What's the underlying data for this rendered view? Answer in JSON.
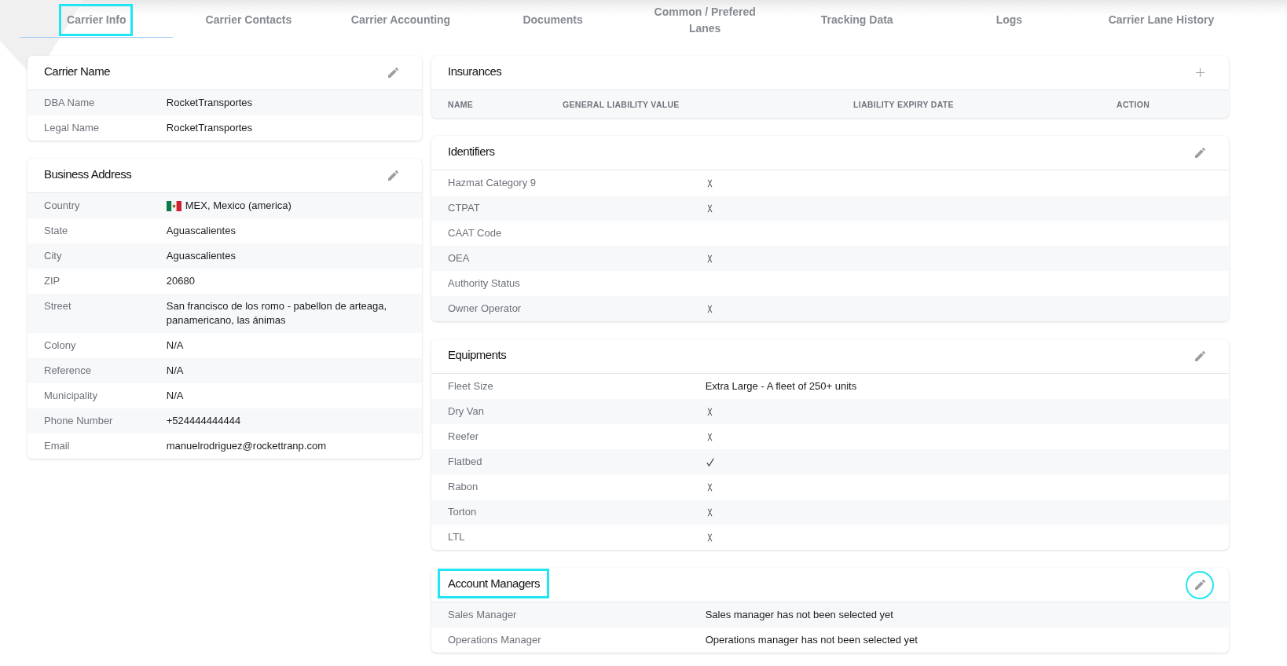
{
  "tabs": [
    {
      "label": "Carrier Info",
      "selected": true,
      "highlighted": true
    },
    {
      "label": "Carrier Contacts",
      "selected": false,
      "highlighted": false
    },
    {
      "label": "Carrier Accounting",
      "selected": false,
      "highlighted": false
    },
    {
      "label": "Documents",
      "selected": false,
      "highlighted": false
    },
    {
      "label": "Common / Prefered Lanes",
      "selected": false,
      "highlighted": false
    },
    {
      "label": "Tracking Data",
      "selected": false,
      "highlighted": false
    },
    {
      "label": "Logs",
      "selected": false,
      "highlighted": false
    },
    {
      "label": "Carrier Lane History",
      "selected": false,
      "highlighted": false
    }
  ],
  "left_cards": [
    {
      "kind": "details",
      "title": "Carrier Name",
      "title_highlighted": false,
      "action": {
        "kind": "edit",
        "highlighted": false
      },
      "rows": [
        {
          "kind": "text",
          "label": "DBA Name",
          "value": "RocketTransportes"
        },
        {
          "kind": "text",
          "label": "Legal Name",
          "value": "RocketTransportes"
        }
      ]
    },
    {
      "kind": "details",
      "title": "Business Address",
      "title_highlighted": false,
      "action": {
        "kind": "edit",
        "highlighted": false
      },
      "rows": [
        {
          "kind": "country",
          "label": "Country",
          "value": "MEX, Mexico (america)"
        },
        {
          "kind": "text",
          "label": "State",
          "value": "Aguascalientes"
        },
        {
          "kind": "text",
          "label": "City",
          "value": "Aguascalientes"
        },
        {
          "kind": "text",
          "label": "ZIP",
          "value": "20680"
        },
        {
          "kind": "text",
          "label": "Street",
          "value": "San francisco de los romo - pabellon de arteaga, panamericano, las ánimas"
        },
        {
          "kind": "text",
          "label": "Colony",
          "value": "N/A"
        },
        {
          "kind": "text",
          "label": "Reference",
          "value": "N/A"
        },
        {
          "kind": "text",
          "label": "Municipality",
          "value": "N/A"
        },
        {
          "kind": "text",
          "label": "Phone Number",
          "value": "+524444444444"
        },
        {
          "kind": "text",
          "label": "Email",
          "value": "manuelrodriguez@rockettranp.com"
        }
      ]
    }
  ],
  "right_cards": [
    {
      "kind": "table",
      "title": "Insurances",
      "title_highlighted": false,
      "action": {
        "kind": "add",
        "highlighted": false
      },
      "columns": [
        "NAME",
        "GENERAL LIABILITY VALUE",
        "LIABILITY EXPIRY DATE",
        "ACTION"
      ]
    },
    {
      "kind": "checklist",
      "title": "Identifiers",
      "title_highlighted": false,
      "action": {
        "kind": "edit",
        "highlighted": false
      },
      "rows": [
        {
          "kind": "boolean",
          "label": "Hazmat Category 9",
          "checked": false
        },
        {
          "kind": "boolean",
          "label": "CTPAT",
          "checked": false
        },
        {
          "kind": "text",
          "label": "CAAT Code"
        },
        {
          "kind": "boolean",
          "label": "OEA",
          "checked": false
        },
        {
          "kind": "text",
          "label": "Authority Status"
        },
        {
          "kind": "boolean",
          "label": "Owner Operator",
          "checked": false
        }
      ]
    },
    {
      "kind": "checklist",
      "title": "Equipments",
      "title_highlighted": false,
      "action": {
        "kind": "edit",
        "highlighted": false
      },
      "rows": [
        {
          "kind": "text",
          "label": "Fleet Size",
          "value": "Extra Large - A fleet of 250+ units"
        },
        {
          "kind": "boolean",
          "label": "Dry Van",
          "checked": false
        },
        {
          "kind": "boolean",
          "label": "Reefer",
          "checked": false
        },
        {
          "kind": "boolean",
          "label": "Flatbed",
          "checked": true
        },
        {
          "kind": "boolean",
          "label": "Rabon",
          "checked": false
        },
        {
          "kind": "boolean",
          "label": "Torton",
          "checked": false
        },
        {
          "kind": "boolean",
          "label": "LTL",
          "checked": false
        }
      ]
    },
    {
      "kind": "details",
      "title": "Account Managers",
      "title_highlighted": true,
      "action": {
        "kind": "edit",
        "highlighted": true
      },
      "rows": [
        {
          "kind": "text",
          "label": "Sales Manager",
          "value": "Sales manager has not been selected yet"
        },
        {
          "kind": "text",
          "label": "Operations Manager",
          "value": "Operations manager has not been selected yet"
        }
      ]
    }
  ]
}
